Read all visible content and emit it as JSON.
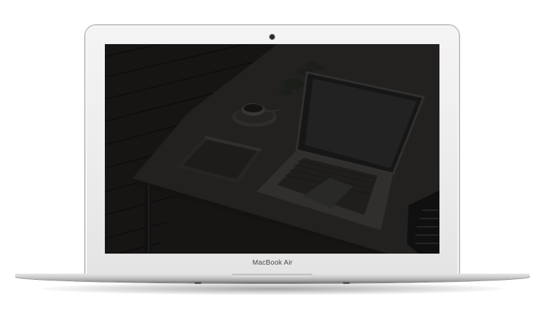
{
  "device": {
    "model_label": "MacBook Air"
  },
  "screen": {
    "wallpaper": "dimmed-photo-desk-laptop-coffee-tablet"
  },
  "colors": {
    "bezel": "#ececec",
    "screen_bg": "#1f1f1f",
    "label_text": "#4a4a4a"
  }
}
